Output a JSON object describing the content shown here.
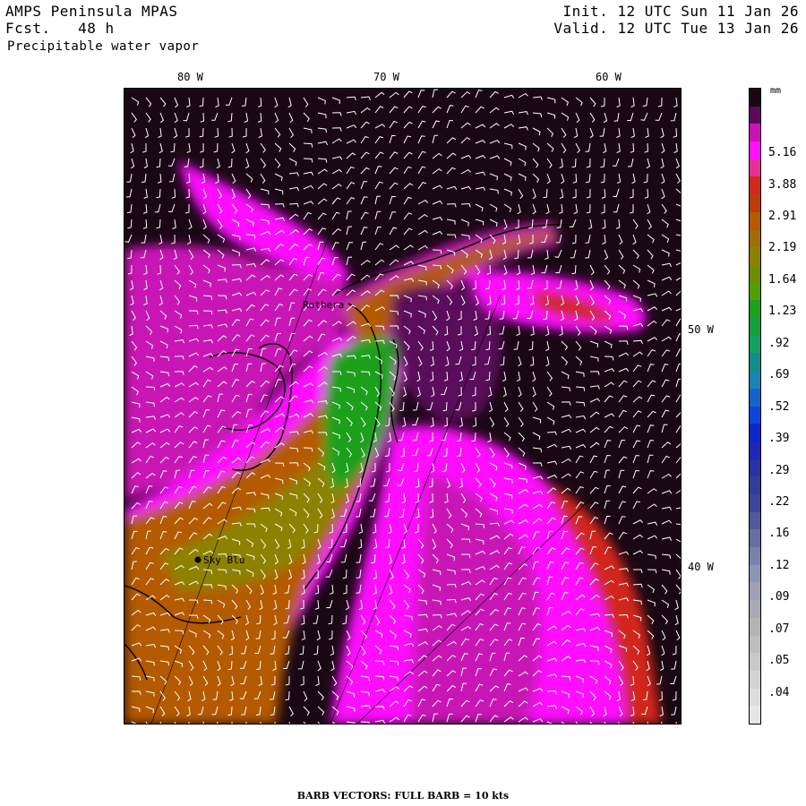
{
  "header": {
    "title": "AMPS Peninsula MPAS",
    "forecast": "Fcst.   48 h",
    "field": "Precipitable water vapor",
    "init": "Init. 12 UTC Sun 11 Jan 26",
    "valid": "Valid. 12 UTC Tue 13 Jan 26"
  },
  "map": {
    "top_longitude_labels": [
      "80 W",
      "70 W",
      "60 W"
    ],
    "right_longitude_labels": [
      "50 W",
      "40 W"
    ],
    "stations": [
      {
        "name": "Rothera"
      },
      {
        "name": "Sky Blu"
      }
    ]
  },
  "colorbar": {
    "units": "mm",
    "labels": [
      "5.16",
      "3.88",
      "2.91",
      "2.19",
      "1.64",
      "1.23",
      ".92",
      ".69",
      ".52",
      ".39",
      ".29",
      ".22",
      ".16",
      ".12",
      ".09",
      ".07",
      ".05",
      ".04"
    ],
    "colors": [
      "#190814",
      "#5a0a5a",
      "#c812b4",
      "#ff10ff",
      "#e63296",
      "#d2281e",
      "#be3c0a",
      "#b45a00",
      "#a06e00",
      "#8c8200",
      "#6e8c00",
      "#50a000",
      "#1ea01e",
      "#14a03c",
      "#14a064",
      "#148c8c",
      "#1e82b4",
      "#1464c8",
      "#0a46dc",
      "#0a28c8",
      "#1e28b4",
      "#2832a0",
      "#323c9a",
      "#3c4696",
      "#505a9a",
      "#646ea0",
      "#7882aa",
      "#8c96b4",
      "#a0a0b4",
      "#aaaab4",
      "#b4b4b4",
      "#bebebe",
      "#c8c8c8",
      "#d2d2d2",
      "#dcdcdc",
      "#e6e6e6"
    ]
  },
  "footer": "BARB VECTORS:  FULL BARB = 10 kts"
}
